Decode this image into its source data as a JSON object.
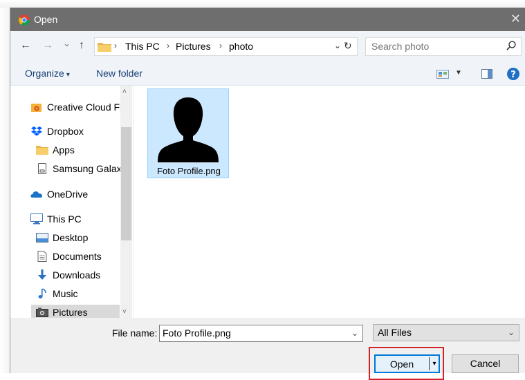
{
  "dialog": {
    "title": "Open",
    "close_glyph": "✕"
  },
  "nav": {
    "back_glyph": "←",
    "forward_glyph": "→",
    "recent_glyph": "⌄",
    "up_glyph": "↑",
    "breadcrumbs": [
      "This PC",
      "Pictures",
      "photo"
    ],
    "separator": "›",
    "dropdown_glyph": "⌄",
    "refresh_glyph": "↻",
    "search_placeholder": "Search photo"
  },
  "toolbar": {
    "organize_label": "Organize",
    "organize_caret": "▾",
    "new_folder_label": "New folder"
  },
  "sidebar": {
    "items": [
      {
        "label": "Creative Cloud Fil",
        "icon": "creative-cloud-icon"
      },
      {
        "label": "Dropbox",
        "icon": "dropbox-icon"
      },
      {
        "label": "Apps",
        "icon": "folder-icon"
      },
      {
        "label": "Samsung Galaxy",
        "icon": "device-icon"
      },
      {
        "label": "OneDrive",
        "icon": "onedrive-icon"
      },
      {
        "label": "This PC",
        "icon": "computer-icon"
      },
      {
        "label": "Desktop",
        "icon": "desktop-icon"
      },
      {
        "label": "Documents",
        "icon": "documents-icon"
      },
      {
        "label": "Downloads",
        "icon": "downloads-icon"
      },
      {
        "label": "Music",
        "icon": "music-icon"
      },
      {
        "label": "Pictures",
        "icon": "pictures-icon"
      }
    ],
    "scroll_up_glyph": "˄",
    "scroll_down_glyph": "˅"
  },
  "files": [
    {
      "name": "Foto Profile.png",
      "icon": "person-silhouette-icon"
    }
  ],
  "bottom": {
    "file_name_label": "File name:",
    "file_name_value": "Foto Profile.png",
    "dropdown_glyph": "⌄",
    "file_type_value": "All Files",
    "open_label": "Open",
    "open_split_glyph": "▾",
    "cancel_label": "Cancel"
  },
  "colors": {
    "titlebar": "#6e6e6e",
    "selection": "#cce8ff",
    "accent": "#0078d7",
    "highlight": "#d0232b"
  }
}
